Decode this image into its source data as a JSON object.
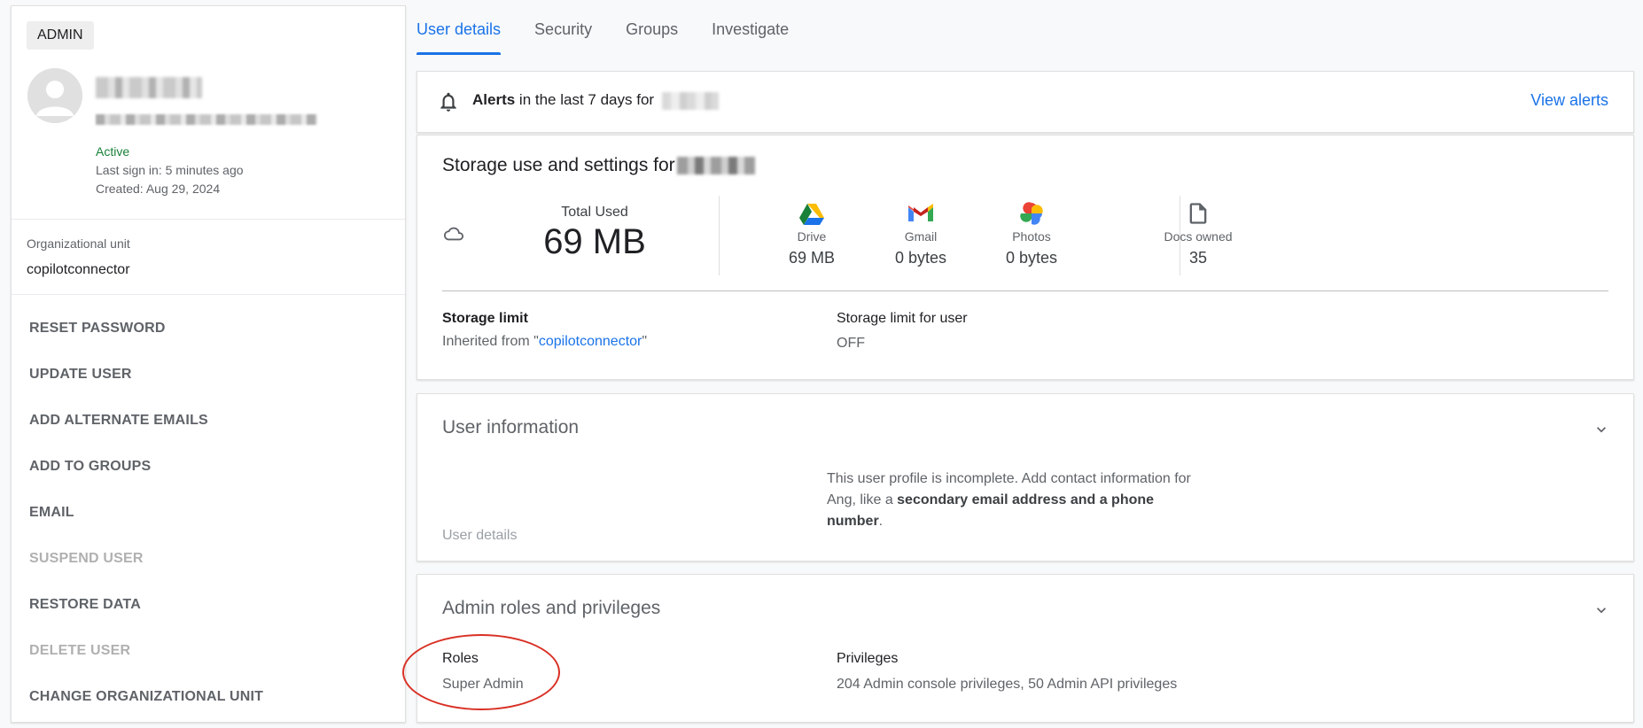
{
  "left": {
    "badge": "ADMIN",
    "status": "Active",
    "last_sign_in": "Last sign in: 5 minutes ago",
    "created": "Created: Aug 29, 2024",
    "ou_label": "Organizational unit",
    "ou_value": "copilotconnector",
    "actions": [
      {
        "label": "RESET PASSWORD"
      },
      {
        "label": "UPDATE USER"
      },
      {
        "label": "ADD ALTERNATE EMAILS"
      },
      {
        "label": "ADD TO GROUPS"
      },
      {
        "label": "EMAIL"
      },
      {
        "label": "SUSPEND USER"
      },
      {
        "label": "RESTORE DATA"
      },
      {
        "label": "DELETE USER"
      },
      {
        "label": "CHANGE ORGANIZATIONAL UNIT"
      }
    ]
  },
  "tabs": [
    "User details",
    "Security",
    "Groups",
    "Investigate"
  ],
  "alerts": {
    "bold": "Alerts",
    "text": "in the last 7 days for",
    "link": "View alerts"
  },
  "storage": {
    "title": "Storage use and settings for",
    "total_label": "Total Used",
    "total_value": "69 MB",
    "services": [
      {
        "label": "Drive",
        "value": "69 MB"
      },
      {
        "label": "Gmail",
        "value": "0 bytes"
      },
      {
        "label": "Photos",
        "value": "0 bytes"
      },
      {
        "label": "Docs owned",
        "value": "35"
      }
    ],
    "limit_label": "Storage limit",
    "limit_prefix": "Inherited from \"",
    "limit_link": "copilotconnector",
    "limit_suffix": "\"",
    "user_limit_label": "Storage limit for user",
    "user_limit_value": "OFF"
  },
  "user_info": {
    "title": "User information",
    "msg_1": "This user profile is incomplete. Add contact information for Ang, like a ",
    "msg_bold": "secondary email address and a phone number",
    "msg_2": ".",
    "link": "User details"
  },
  "roles": {
    "title": "Admin roles and privileges",
    "roles_label": "Roles",
    "roles_value": "Super Admin",
    "priv_label": "Privileges",
    "priv_value": "204 Admin console privileges, 50 Admin API privileges"
  },
  "colors": {
    "accent": "#1a73e8",
    "active": "#188038",
    "annotation": "#d93025"
  }
}
